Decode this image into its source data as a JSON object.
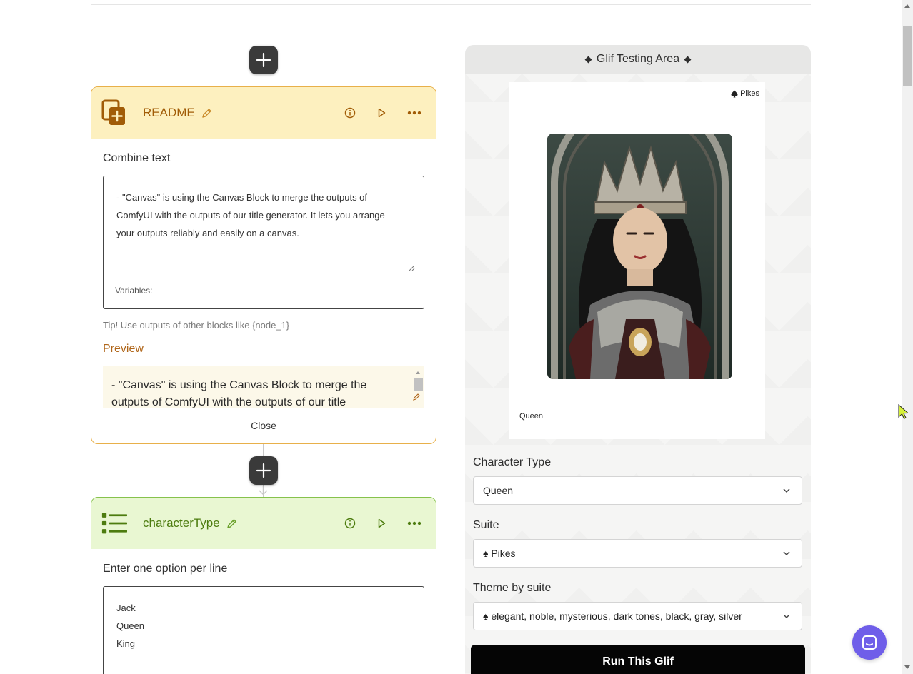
{
  "readme_block": {
    "title": "README",
    "field_label": "Combine text",
    "text_lines": [
      "- \"Canvas\" is using the Canvas Block to merge the outputs of",
      "ComfyUI with the outputs of our title generator. It lets you arrange",
      "your outputs reliably and easily on a canvas."
    ],
    "variables_label": "Variables:",
    "tip": "Tip! Use outputs of other blocks like {node_1}",
    "preview_label": "Preview",
    "preview_lines": [
      "- \"Canvas\" is using the Canvas Block to merge the",
      "outputs of ComfyUI with the outputs of our title"
    ],
    "close_label": "Close",
    "accent": "#a15c07",
    "header_bg": "#fdf0bf"
  },
  "chartype_block": {
    "title": "characterType",
    "field_label": "Enter one option per line",
    "options": [
      "Jack",
      "Queen",
      "King"
    ],
    "accent": "#4d7c0f",
    "header_bg": "#e9f7d2"
  },
  "testing_area": {
    "title": "Glif Testing Area",
    "card": {
      "suit_tag": "Pikes",
      "caption": "Queen"
    },
    "fields": [
      {
        "label": "Character Type",
        "value": "Queen"
      },
      {
        "label": "Suite",
        "value": "♠ Pikes"
      },
      {
        "label": "Theme by suite",
        "value": "♠ elegant, noble, mysterious, dark tones, black, gray, silver"
      }
    ],
    "run_button": "Run This Glif"
  },
  "icons": [
    "plus-icon",
    "copy-plus-icon",
    "pencil-icon",
    "info-icon",
    "play-icon",
    "more-icon",
    "list-icon",
    "chevron-down-icon",
    "spade-icon",
    "chat-icon",
    "cursor-icon"
  ]
}
